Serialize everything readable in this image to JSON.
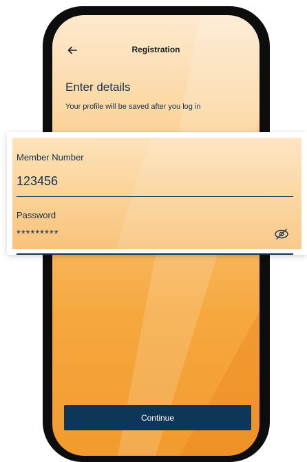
{
  "screen": {
    "nav": {
      "title": "Registration",
      "back_icon": "arrow-left-icon"
    },
    "heading": "Enter details",
    "subheading": "Your profile will be saved after you log in",
    "continue_label": "Continue"
  },
  "form": {
    "member_number": {
      "label": "Member Number",
      "value": "123456"
    },
    "password": {
      "label": "Password",
      "value": "*********",
      "toggle_icon": "eye-off-icon"
    }
  },
  "colors": {
    "primary": "#0e3659",
    "text": "#12304f",
    "gradient_top": "#fde9cf",
    "gradient_bottom": "#f29b2e"
  }
}
